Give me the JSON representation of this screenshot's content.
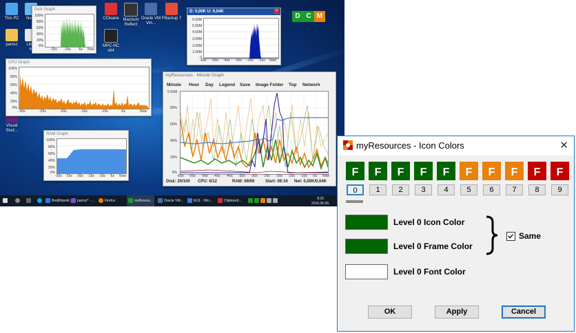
{
  "desktop": {
    "icons": [
      {
        "label": "This PC"
      },
      {
        "label": "Netw"
      },
      {
        "label": "panisz"
      },
      {
        "label": "Libre"
      },
      {
        "label": "6."
      },
      {
        "label": "CCleane"
      },
      {
        "label": "Macrium Reflect"
      },
      {
        "label": "Oracle VM Virt..."
      },
      {
        "label": "FBackup 7"
      },
      {
        "label": "MPC-HC x64"
      },
      {
        "label": "Mi"
      },
      {
        "label": "Visual Stud..."
      }
    ],
    "dcm": [
      "D",
      "C",
      "M"
    ]
  },
  "disk_graph": {
    "title": "Disk Graph",
    "yticks": [
      "100%",
      "80%",
      "60%",
      "40%",
      "20%",
      "0%"
    ],
    "xticks": [
      "-25s",
      "-15s",
      "-5s",
      "Now"
    ]
  },
  "net_graph": {
    "title": "D: 0,00K   U: 0,04K",
    "yticks": [
      "6.00M",
      "5.00M",
      "4.00M",
      "3.00M",
      "2.00M",
      "1.00M",
      "0"
    ],
    "xticks": [
      "-60s",
      "-50s",
      "-40s",
      "-30s",
      "-20s",
      "-10s",
      "Now"
    ]
  },
  "cpu_graph": {
    "title": "CPU Graph",
    "yticks": [
      "100%",
      "80%",
      "60%",
      "40%",
      "20%",
      "0%"
    ],
    "xticks": [
      "-30s",
      "-25s",
      "-20s",
      "-15s",
      "-10s",
      "-5s",
      "Now"
    ]
  },
  "ram_graph": {
    "title": "RAM Graph",
    "yticks": [
      "100%",
      "80%",
      "60%",
      "40%",
      "20%",
      "0%"
    ],
    "xticks": [
      "-30s",
      "-25s",
      "-20s",
      "-15s",
      "-10s",
      "-5s",
      "Now"
    ]
  },
  "minute_graph": {
    "title": "myResources - Minute Graph",
    "menu": [
      "Minute",
      "Hour",
      "Day",
      "Legend",
      "Save",
      "Image Folder",
      "Top",
      "Network"
    ],
    "yticks": [
      "5.65M",
      "80%",
      "60%",
      "40%",
      "20%",
      "0%"
    ],
    "xticks": [
      "-60s",
      "-55s",
      "-50s",
      "-45s",
      "-40s",
      "-35s",
      "-30s",
      "-25s",
      "-20s",
      "-15s",
      "-10s",
      "-5s",
      "Now"
    ],
    "status": {
      "disk": "Disk: 20/100",
      "cpu": "CPU: 6/12",
      "ram": "RAM: 69/69",
      "start": "Start: 08:16",
      "net": "Net: 0,00K/0,04K"
    }
  },
  "taskbar": {
    "items": [
      "Beállításokl...",
      "panisz* - ...",
      "Firefox",
      "myResour...",
      "Oracle VM...",
      "IE11 - Win...",
      "Clipboard..."
    ],
    "time": "8:25",
    "date": "2016.06.06."
  },
  "dialog": {
    "title": "myResources - Icon Colors",
    "close_glyph": "✕",
    "letter": "F",
    "levels": [
      {
        "label": "0",
        "color": "#006400"
      },
      {
        "label": "1",
        "color": "#006400"
      },
      {
        "label": "2",
        "color": "#006400"
      },
      {
        "label": "3",
        "color": "#006400"
      },
      {
        "label": "4",
        "color": "#006400"
      },
      {
        "label": "5",
        "color": "#e8820c"
      },
      {
        "label": "6",
        "color": "#e8820c"
      },
      {
        "label": "7",
        "color": "#e8820c"
      },
      {
        "label": "8",
        "color": "#c40000"
      },
      {
        "label": "9",
        "color": "#c40000"
      }
    ],
    "selected_level": 0,
    "icon_color_label": "Level 0 Icon Color",
    "icon_color": "#006400",
    "frame_color_label": "Level 0 Frame Color",
    "frame_color": "#006400",
    "font_color_label": "Level 0 Font Color",
    "font_color": "#ffffff",
    "same_label": "Same",
    "same_checked": true,
    "buttons": {
      "ok": "OK",
      "apply": "Apply",
      "cancel": "Cancel"
    }
  }
}
